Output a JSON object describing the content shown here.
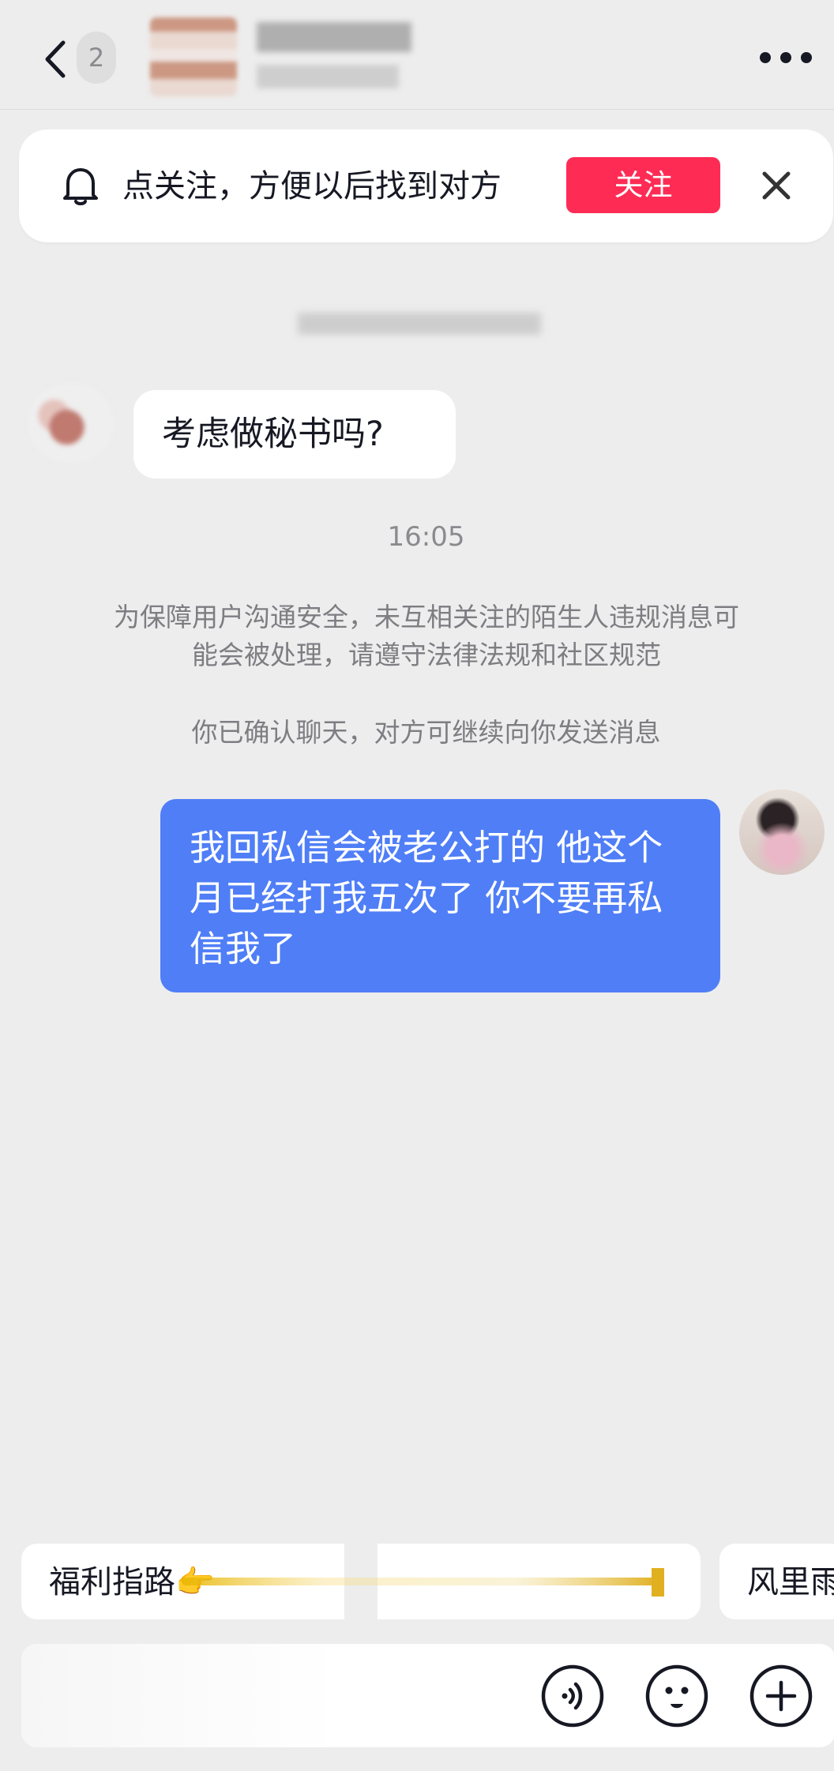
{
  "header": {
    "unread_count": "2",
    "back_icon": "chevron-left-icon",
    "more_icon": "more-dots-icon"
  },
  "follow_banner": {
    "text": "点关注，方便以后找到对方",
    "button_label": "关注",
    "bell_icon": "bell-icon",
    "close_icon": "close-icon",
    "button_color": "#fe2c55"
  },
  "messages": {
    "incoming_text": "考虑做秘书吗?",
    "time": "16:05",
    "notice": "为保障用户沟通安全，未互相关注的陌生人违规消息可能会被处理，请遵守法律法规和社区规范",
    "confirm": "你已确认聊天，对方可继续向你发送消息",
    "outgoing_text": "我回私信会被老公打的 他这个月已经打我五次了 你不要再私信我了",
    "outgoing_color": "#4f7ef7"
  },
  "suggestions": {
    "chip1": "福利指路👉",
    "chip2": "风里雨"
  },
  "input_bar": {
    "voice_icon": "voice-icon",
    "emoji_icon": "emoji-icon",
    "plus_icon": "plus-icon"
  }
}
